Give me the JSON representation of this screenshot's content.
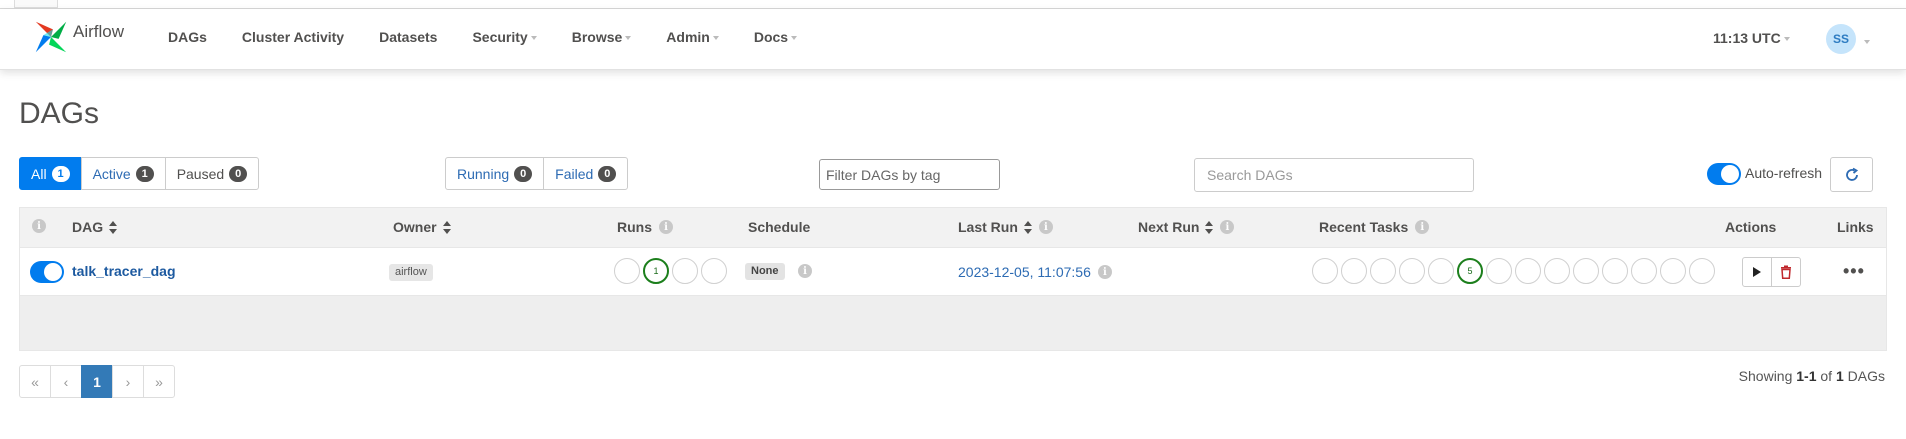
{
  "brand": {
    "name": "Airflow"
  },
  "nav": {
    "items": [
      {
        "label": "DAGs",
        "dropdown": false
      },
      {
        "label": "Cluster Activity",
        "dropdown": false
      },
      {
        "label": "Datasets",
        "dropdown": false
      },
      {
        "label": "Security",
        "dropdown": true
      },
      {
        "label": "Browse",
        "dropdown": true
      },
      {
        "label": "Admin",
        "dropdown": true
      },
      {
        "label": "Docs",
        "dropdown": true
      }
    ],
    "time": "11:13 UTC",
    "user_initials": "SS"
  },
  "page": {
    "title": "DAGs"
  },
  "status_filters": {
    "all_label": "All",
    "all_count": "1",
    "active_label": "Active",
    "active_count": "1",
    "paused_label": "Paused",
    "paused_count": "0"
  },
  "run_filters": {
    "running_label": "Running",
    "running_count": "0",
    "failed_label": "Failed",
    "failed_count": "0"
  },
  "tag_filter": {
    "placeholder": "Filter DAGs by tag"
  },
  "search": {
    "placeholder": "Search DAGs"
  },
  "auto_refresh": {
    "label": "Auto-refresh",
    "enabled": true
  },
  "table": {
    "headers": {
      "dag": "DAG",
      "owner": "Owner",
      "runs": "Runs",
      "schedule": "Schedule",
      "last_run": "Last Run",
      "next_run": "Next Run",
      "recent_tasks": "Recent Tasks",
      "actions": "Actions",
      "links": "Links"
    },
    "rows": [
      {
        "dag_id": "talk_tracer_dag",
        "owner": "airflow",
        "runs": [
          "",
          "1",
          "",
          ""
        ],
        "schedule": "None",
        "last_run": "2023-12-05, 11:07:56",
        "next_run": "",
        "recent_tasks": [
          "",
          "",
          "",
          "",
          "",
          "5",
          "",
          "",
          "",
          "",
          "",
          "",
          "",
          "",
          ""
        ],
        "more_glyph": "•••"
      }
    ]
  },
  "pagination": {
    "first": "«",
    "prev": "‹",
    "current": "1",
    "next": "›",
    "last": "»"
  },
  "showing": {
    "prefix": "Showing",
    "range": "1-1",
    "of": "of",
    "total": "1",
    "suffix": "DAGs"
  },
  "colors": {
    "accent": "#017cee",
    "success": "#1c7f1c",
    "link": "#1d5aa0",
    "delete": "#c0282d"
  },
  "icons": {
    "refresh": "refresh-icon",
    "trigger": "play-icon",
    "delete": "trash-icon",
    "info": "info-icon"
  }
}
